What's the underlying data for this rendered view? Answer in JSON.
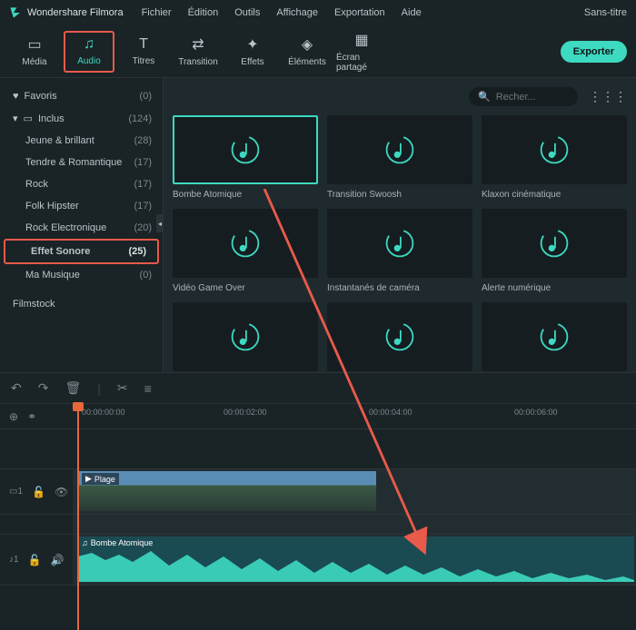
{
  "app": {
    "name": "Wondershare Filmora",
    "document_title": "Sans-titre"
  },
  "menu": {
    "items": [
      "Fichier",
      "Édition",
      "Outils",
      "Affichage",
      "Exportation",
      "Aide"
    ]
  },
  "tabs": [
    {
      "id": "media",
      "label": "Média"
    },
    {
      "id": "audio",
      "label": "Audio"
    },
    {
      "id": "titres",
      "label": "Titres"
    },
    {
      "id": "transition",
      "label": "Transition"
    },
    {
      "id": "effets",
      "label": "Effets"
    },
    {
      "id": "elements",
      "label": "Éléments"
    },
    {
      "id": "ecran",
      "label": "Écran partagé"
    }
  ],
  "export_label": "Exporter",
  "sidebar": {
    "favoris": {
      "label": "Favoris",
      "count": "(0)"
    },
    "inclus": {
      "label": "Inclus",
      "count": "(124)"
    },
    "categories": [
      {
        "label": "Jeune & brillant",
        "count": "(28)"
      },
      {
        "label": "Tendre & Romantique",
        "count": "(17)"
      },
      {
        "label": "Rock",
        "count": "(17)"
      },
      {
        "label": "Folk Hipster",
        "count": "(17)"
      },
      {
        "label": "Rock Electronique",
        "count": "(20)"
      },
      {
        "label": "Effet Sonore",
        "count": "(25)"
      },
      {
        "label": "Ma Musique",
        "count": "(0)"
      }
    ],
    "filmstock": "Filmstock"
  },
  "search": {
    "placeholder": "Recher..."
  },
  "thumbs": [
    {
      "label": "Bombe Atomique"
    },
    {
      "label": "Transition Swoosh"
    },
    {
      "label": "Klaxon cinématique"
    },
    {
      "label": "Vidéo Game Over"
    },
    {
      "label": "Instantanés de caméra"
    },
    {
      "label": "Alerte numérique"
    },
    {
      "label": ""
    },
    {
      "label": ""
    },
    {
      "label": ""
    }
  ],
  "timeline": {
    "marks": [
      "00:00:00:00",
      "00:00:02:00",
      "00:00:04:00",
      "00:00:06:00"
    ],
    "video_clip": "Plage",
    "audio_clip": "Bombe Atomique",
    "track_video": "1",
    "track_audio": "1"
  }
}
